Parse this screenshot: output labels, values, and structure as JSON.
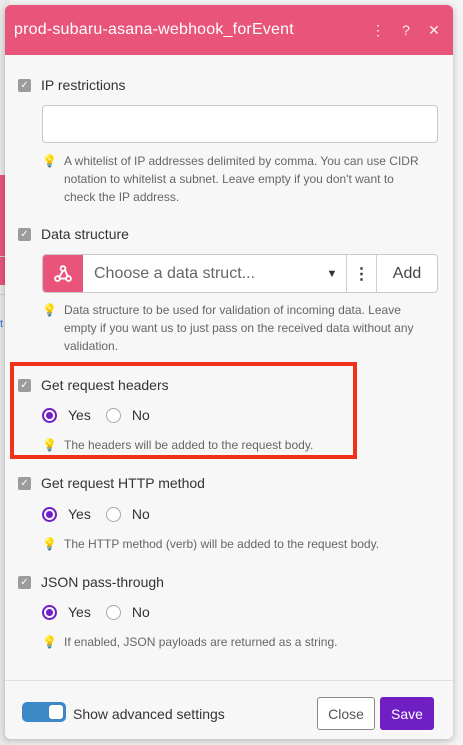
{
  "dialog": {
    "title": "prod-subaru-asana-webhook_forEvent",
    "header_icons": [
      "more-vertical-icon",
      "help-icon",
      "close-icon"
    ],
    "header_glyphs": {
      "more": "⋮",
      "help": "?",
      "close": "✕"
    },
    "brand_color": "#e9547a",
    "accent_color": "#6f1fc4"
  },
  "ip_restrictions": {
    "label": "IP restrictions",
    "value": "",
    "placeholder": "",
    "hint": "A whitelist of IP addresses delimited by comma. You can use CIDR notation to whitelist a subnet. Leave empty if you don't want to check the IP address."
  },
  "data_structure": {
    "label": "Data structure",
    "placeholder": "Choose a data struct...",
    "menu_glyph": "⋮",
    "add_label": "Add",
    "hint": "Data structure to be used for validation of incoming data. Leave empty if you want us to just pass on the received data without any validation."
  },
  "request_headers": {
    "label": "Get request headers",
    "yes_label": "Yes",
    "no_label": "No",
    "selected": "Yes",
    "hint": "The headers will be added to the request body."
  },
  "http_method": {
    "label": "Get request HTTP method",
    "yes_label": "Yes",
    "no_label": "No",
    "selected": "Yes",
    "hint": "The HTTP method (verb) will be added to the request body."
  },
  "json_passthrough": {
    "label": "JSON pass-through",
    "yes_label": "Yes",
    "no_label": "No",
    "selected": "Yes",
    "hint": "If enabled, JSON payloads are returned as a string."
  },
  "footer": {
    "advanced_label": "Show advanced settings",
    "advanced_enabled": true,
    "close_label": "Close",
    "save_label": "Save"
  },
  "background": {
    "fragment_text": "t"
  },
  "highlight_color": "#f0321c"
}
